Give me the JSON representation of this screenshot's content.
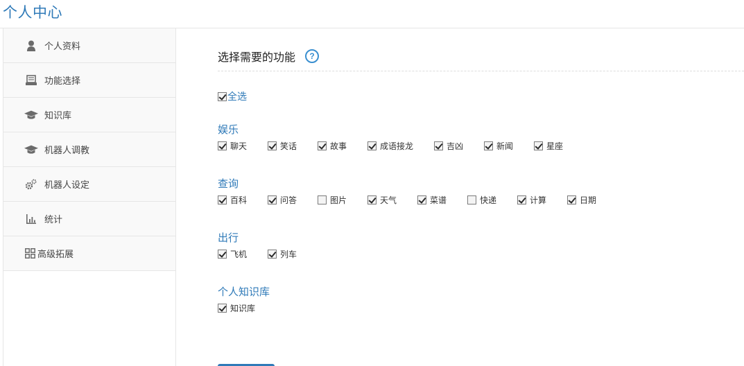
{
  "page": {
    "title": "个人中心"
  },
  "sidebar": {
    "items": [
      {
        "label": "个人资料",
        "icon": "user-icon"
      },
      {
        "label": "功能选择",
        "icon": "tray-icon"
      },
      {
        "label": "知识库",
        "icon": "graduation-cap-icon"
      },
      {
        "label": "机器人调教",
        "icon": "graduation-cap-icon"
      },
      {
        "label": "机器人设定",
        "icon": "gears-icon"
      },
      {
        "label": "统计",
        "icon": "bar-chart-icon"
      },
      {
        "label": "高级拓展",
        "icon": "grid-icon"
      }
    ]
  },
  "main": {
    "section_title": "选择需要的功能",
    "help_glyph": "?",
    "select_all": {
      "label": "全选",
      "checked": true
    },
    "groups": [
      {
        "title": "娱乐",
        "items": [
          {
            "label": "聊天",
            "checked": true
          },
          {
            "label": "笑话",
            "checked": true
          },
          {
            "label": "故事",
            "checked": true
          },
          {
            "label": "成语接龙",
            "checked": true
          },
          {
            "label": "吉凶",
            "checked": true
          },
          {
            "label": "新闻",
            "checked": true
          },
          {
            "label": "星座",
            "checked": true
          }
        ]
      },
      {
        "title": "查询",
        "items": [
          {
            "label": "百科",
            "checked": true
          },
          {
            "label": "问答",
            "checked": true
          },
          {
            "label": "图片",
            "checked": false
          },
          {
            "label": "天气",
            "checked": true
          },
          {
            "label": "菜谱",
            "checked": true
          },
          {
            "label": "快递",
            "checked": false
          },
          {
            "label": "计算",
            "checked": true
          },
          {
            "label": "日期",
            "checked": true
          }
        ]
      },
      {
        "title": "出行",
        "items": [
          {
            "label": "飞机",
            "checked": true
          },
          {
            "label": "列车",
            "checked": true
          }
        ]
      },
      {
        "title": "个人知识库",
        "items": [
          {
            "label": "知识库",
            "checked": true
          }
        ]
      }
    ]
  },
  "colors": {
    "accent": "#2f7ab8",
    "help": "#3a8fd0",
    "border": "#e6e6e6",
    "nav_bg": "#f9f9f9"
  }
}
